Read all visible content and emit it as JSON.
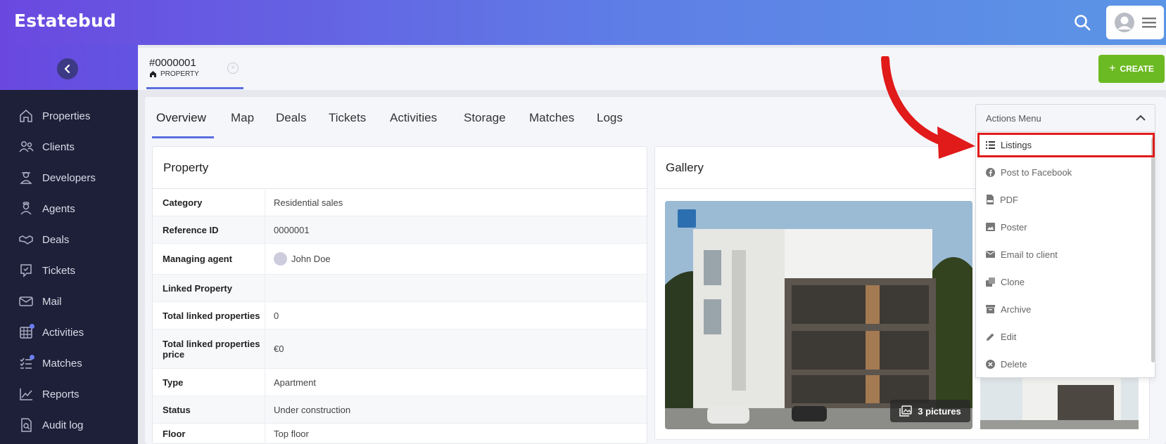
{
  "app": {
    "name": "Estatebud"
  },
  "sidebar": {
    "items": [
      {
        "label": "Properties",
        "icon": "home-icon"
      },
      {
        "label": "Clients",
        "icon": "users-icon"
      },
      {
        "label": "Developers",
        "icon": "developer-icon"
      },
      {
        "label": "Agents",
        "icon": "agent-icon"
      },
      {
        "label": "Deals",
        "icon": "handshake-icon"
      },
      {
        "label": "Tickets",
        "icon": "ticket-icon"
      },
      {
        "label": "Mail",
        "icon": "mail-icon"
      },
      {
        "label": "Activities",
        "icon": "calendar-icon"
      },
      {
        "label": "Matches",
        "icon": "matches-icon"
      },
      {
        "label": "Reports",
        "icon": "chart-icon"
      },
      {
        "label": "Audit log",
        "icon": "audit-icon"
      }
    ]
  },
  "page_tab": {
    "id": "#0000001",
    "type": "PROPERTY"
  },
  "create_label": "CREATE",
  "subtabs": [
    "Overview",
    "Map",
    "Deals",
    "Tickets",
    "Activities",
    "Storage",
    "Matches",
    "Logs"
  ],
  "property": {
    "title": "Property",
    "rows": [
      {
        "key": "Category",
        "value": "Residential sales"
      },
      {
        "key": "Reference ID",
        "value": "0000001"
      },
      {
        "key": "Managing agent",
        "value": "John Doe"
      },
      {
        "key": "Linked Property",
        "value": ""
      },
      {
        "key": "Total linked properties",
        "value": "0"
      },
      {
        "key": "Total linked properties price",
        "value": "€0"
      },
      {
        "key": "Type",
        "value": "Apartment"
      },
      {
        "key": "Status",
        "value": "Under construction"
      },
      {
        "key": "Floor",
        "value": "Top floor"
      }
    ]
  },
  "gallery": {
    "title": "Gallery",
    "pictures_label": "3 pictures"
  },
  "actions": {
    "header": "Actions Menu",
    "items": [
      "Listings",
      "Post to Facebook",
      "PDF",
      "Poster",
      "Email to client",
      "Clone",
      "Archive",
      "Edit",
      "Delete"
    ]
  },
  "colors": {
    "accent": "#5b6ee0",
    "create": "#6cba23",
    "highlight": "#e11a1a",
    "sidebar": "#1d2038"
  }
}
